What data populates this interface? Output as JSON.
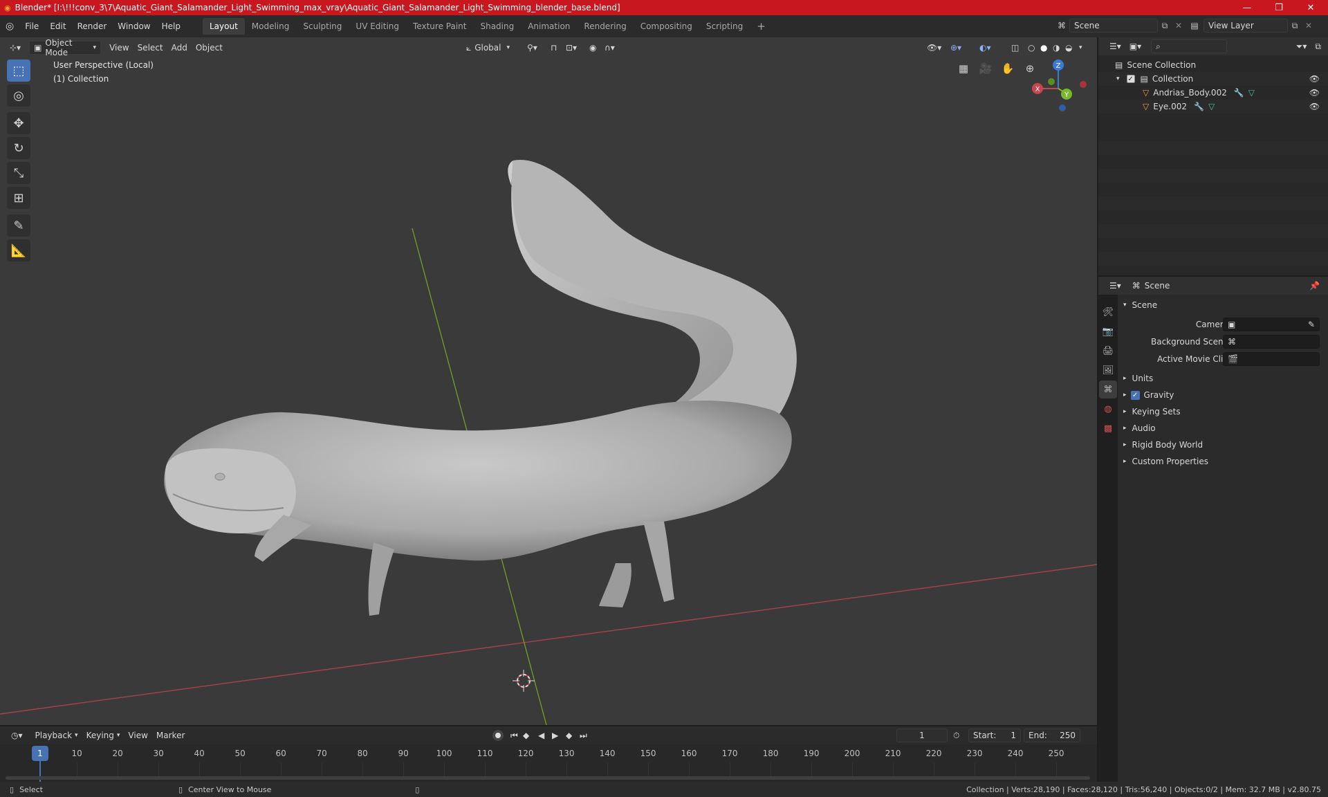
{
  "window": {
    "title": "Blender* [I:\\!!!conv_3\\7\\Aquatic_Giant_Salamander_Light_Swimming_max_vray\\Aquatic_Giant_Salamander_Light_Swimming_blender_base.blend]",
    "minimize": "—",
    "maximize": "❐",
    "close": "✕"
  },
  "menu": [
    "File",
    "Edit",
    "Render",
    "Window",
    "Help"
  ],
  "workspaces": [
    "Layout",
    "Modeling",
    "Sculpting",
    "UV Editing",
    "Texture Paint",
    "Shading",
    "Animation",
    "Rendering",
    "Compositing",
    "Scripting"
  ],
  "active_workspace": "Layout",
  "add_workspace": "+",
  "scene_selector": {
    "label": "Scene"
  },
  "view_layer_selector": {
    "label": "View Layer"
  },
  "viewport_header": {
    "mode": "Object Mode",
    "menus": [
      "View",
      "Select",
      "Add",
      "Object"
    ],
    "transform_orientation": "Global"
  },
  "viewport_info": {
    "line1": "User Perspective (Local)",
    "line2": "(1) Collection"
  },
  "gizmo": {
    "x": "X",
    "y": "Y",
    "z": "Z"
  },
  "outliner": {
    "scene_collection": "Scene Collection",
    "collection": "Collection",
    "objects": [
      "Andrias_Body.002",
      "Eye.002"
    ]
  },
  "properties": {
    "scene_name": "Scene",
    "panel_title": "Scene",
    "camera_label": "Camera",
    "bg_scene_label": "Background Scene",
    "movie_clip_label": "Active Movie Clip",
    "sections": [
      "Units",
      "Gravity",
      "Keying Sets",
      "Audio",
      "Rigid Body World",
      "Custom Properties"
    ]
  },
  "timeline": {
    "menus": [
      "Playback",
      "Keying",
      "View",
      "Marker"
    ],
    "current_frame": "1",
    "start_label": "Start:",
    "start": "1",
    "end_label": "End:",
    "end": "250",
    "ticks": [
      "1",
      "10",
      "20",
      "30",
      "40",
      "50",
      "60",
      "70",
      "80",
      "90",
      "100",
      "110",
      "120",
      "130",
      "140",
      "150",
      "160",
      "170",
      "180",
      "190",
      "200",
      "210",
      "220",
      "230",
      "240",
      "250"
    ]
  },
  "status": {
    "left": "Select",
    "middle": "Center View to Mouse",
    "right": "Collection | Verts:28,190 | Faces:28,120 | Tris:56,240 | Objects:0/2 | Mem: 32.7 MB | v2.80.75"
  },
  "colors": {
    "title_bar": "#c8171e",
    "accent": "#4772b3",
    "axis_x": "#c8474f",
    "axis_y": "#7ab82c",
    "axis_z": "#3a7bd5"
  }
}
